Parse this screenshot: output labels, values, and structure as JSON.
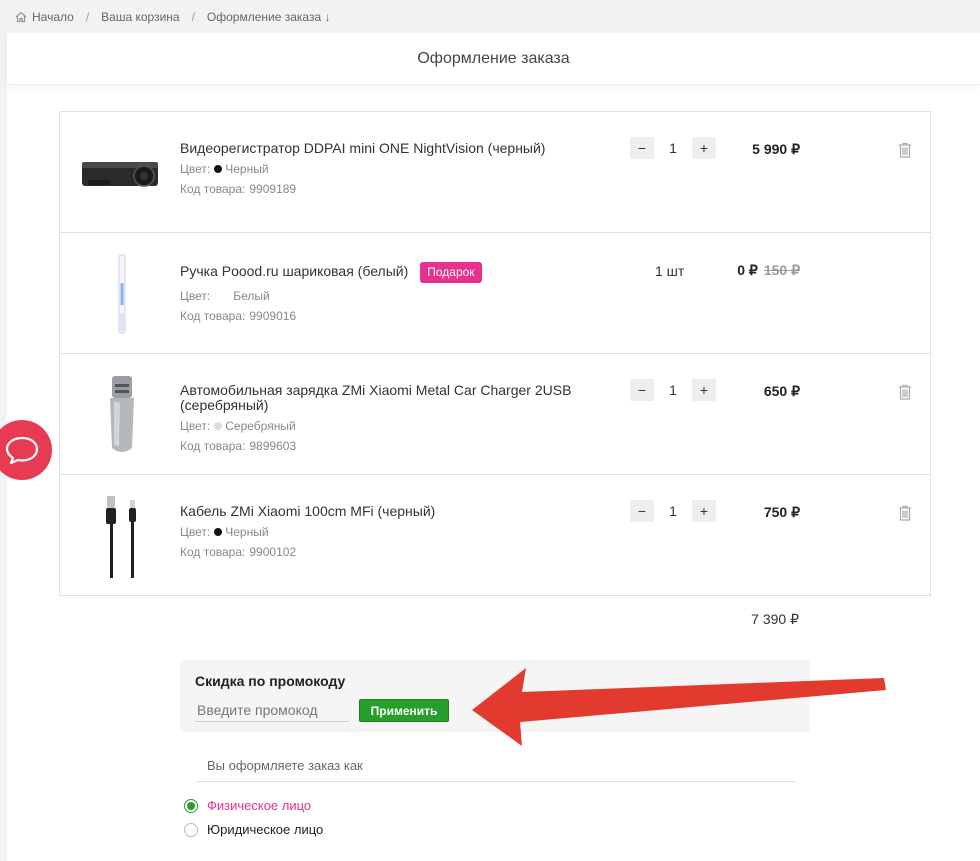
{
  "breadcrumb": {
    "home": "Начало",
    "cart": "Ваша корзина",
    "current": "Оформление заказа ↓"
  },
  "page_title": "Оформление заказа",
  "cart": {
    "items": [
      {
        "name": "Видеорегистратор DDPAI mini ONE NightVision (черный)",
        "color_label": "Цвет:",
        "color_value": "Черный",
        "color_swatch": "#111111",
        "code_label": "Код товара:",
        "code": "9909189",
        "qty": "1",
        "price": "5 990 ₽",
        "icon": "dashcam-image"
      },
      {
        "name": "Ручка Poood.ru шариковая (белый)",
        "badge": "Подарок",
        "color_label": "Цвет:",
        "color_value": "Белый",
        "color_swatch": "#ffffff",
        "code_label": "Код товара:",
        "code": "9909016",
        "qty_static": "1 шт",
        "price": "0 ₽",
        "old_price": "150 ₽",
        "icon": "pen-image"
      },
      {
        "name": "Автомобильная зарядка ZMi Xiaomi Metal Car Charger 2USB (серебряный)",
        "color_label": "Цвет:",
        "color_value": "Серебряный",
        "color_swatch": "#dddddd",
        "code_label": "Код товара:",
        "code": "9899603",
        "qty": "1",
        "price": "650 ₽",
        "icon": "car-charger-image"
      },
      {
        "name": "Кабель ZMi Xiaomi 100cm MFi (черный)",
        "color_label": "Цвет:",
        "color_value": "Черный",
        "color_swatch": "#111111",
        "code_label": "Код товара:",
        "code": "9900102",
        "qty": "1",
        "price": "750 ₽",
        "icon": "cable-image"
      }
    ],
    "qty_minus": "−",
    "qty_plus": "+",
    "total": "7 390 ₽"
  },
  "promo": {
    "title": "Скидка по промокоду",
    "placeholder": "Введите промокод",
    "value": "",
    "apply_label": "Применить"
  },
  "order_as": {
    "heading": "Вы оформляете заказ как",
    "options": [
      {
        "label": "Физическое лицо",
        "selected": true,
        "color": "#e8318d"
      },
      {
        "label": "Юридическое лицо",
        "selected": false,
        "color": "#222222"
      }
    ]
  },
  "colors": {
    "accent_green": "#27a02b",
    "gift_pink": "#e8318d",
    "chat_red": "#e73b54",
    "annotation_arrow": "#e23a2e"
  },
  "icons": [
    "home-icon",
    "trash-icon",
    "chat-icon",
    "annotation-arrow"
  ]
}
